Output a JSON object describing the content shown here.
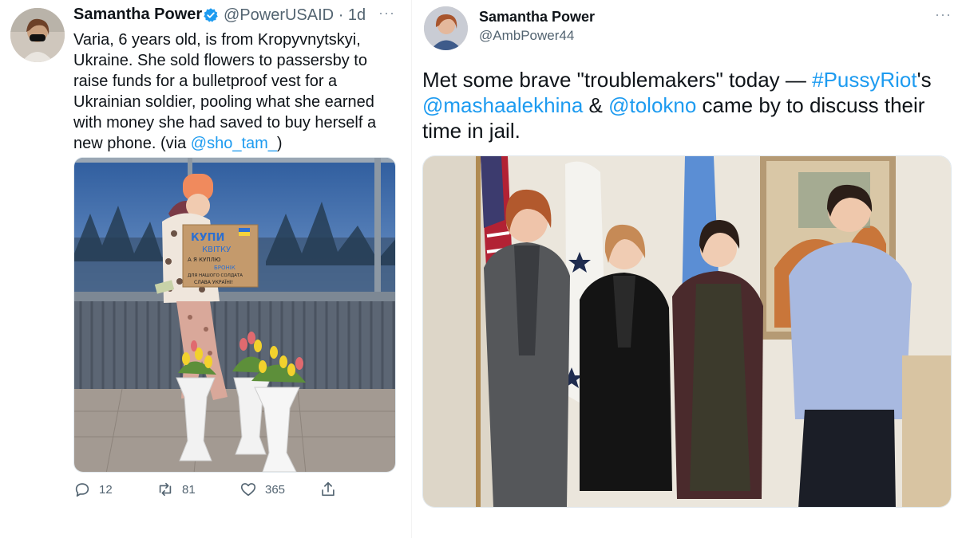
{
  "left_tweet": {
    "name": "Samantha Power",
    "handle": "@PowerUSAID",
    "separator": "·",
    "age": "1d",
    "more": "···",
    "text_main": "Varia, 6 years old, is from Kropyvnytskyi, Ukraine. She sold flowers to passersby to raise funds for a bulletproof vest for a Ukrainian soldier, pooling what she earned with money she had saved to buy herself a new phone. (via ",
    "text_link": "@sho_tam_",
    "text_end": ")",
    "sign_lines": [
      "КУПИ",
      "КВІТКУ",
      "А Я КУПЛЮ",
      "БРОНІК",
      "ДЛЯ НАШОГО СОЛДАТА",
      "СЛАВА УКРАЇНІ!"
    ],
    "actions": {
      "reply_count": "12",
      "retweet_count": "81",
      "like_count": "365"
    }
  },
  "right_tweet": {
    "name": "Samantha Power",
    "handle": "@AmbPower44",
    "more": "···",
    "text_1": "Met some brave \"troublemakers\" today — ",
    "hashtag": "#PussyRiot",
    "text_2": "'s ",
    "mention_1": "@mashaalekhina",
    "text_3": " & ",
    "mention_2": "@tolokno",
    "text_4": " came by to discuss their time in jail."
  },
  "colors": {
    "link": "#1d9bf0",
    "verified": "#1d9bf0",
    "secondary_text": "#536471"
  }
}
